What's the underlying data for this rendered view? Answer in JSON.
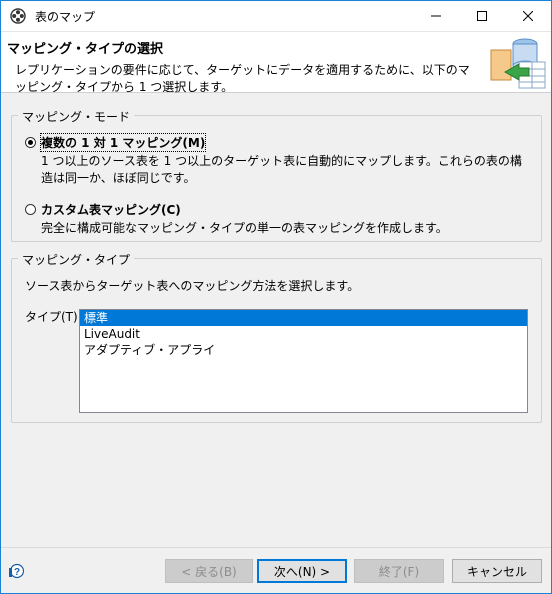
{
  "window": {
    "title": "表のマップ"
  },
  "header": {
    "title": "マッピング・タイプの選択",
    "description": "レプリケーションの要件に応じて、ターゲットにデータを適用するために、以下のマッピング・タイプから 1 つ選択します。"
  },
  "mapping_mode": {
    "label": "マッピング・モード",
    "options": [
      {
        "label": "複数の 1 対 1 マッピング(M)",
        "selected": true,
        "description": "1 つ以上のソース表を 1 つ以上のターゲット表に自動的にマップします。これらの表の構造は同一か、ほぼ同じです。"
      },
      {
        "label": "カスタム表マッピング(C)",
        "selected": false,
        "description": "完全に構成可能なマッピング・タイプの単一の表マッピングを作成します。"
      }
    ]
  },
  "mapping_type": {
    "label": "マッピング・タイプ",
    "instruction": "ソース表からターゲット表へのマッピング方法を選択します。",
    "type_label": "タイプ(T):",
    "items": [
      "標準",
      "LiveAudit",
      "アダプティブ・アプライ"
    ],
    "selected_index": 0
  },
  "buttons": {
    "back": "< 戻る(B)",
    "next": "次へ(N) >",
    "finish": "終了(F)",
    "cancel": "キャンセル"
  },
  "colors": {
    "accent": "#0078d7",
    "border": "#1883d7"
  }
}
